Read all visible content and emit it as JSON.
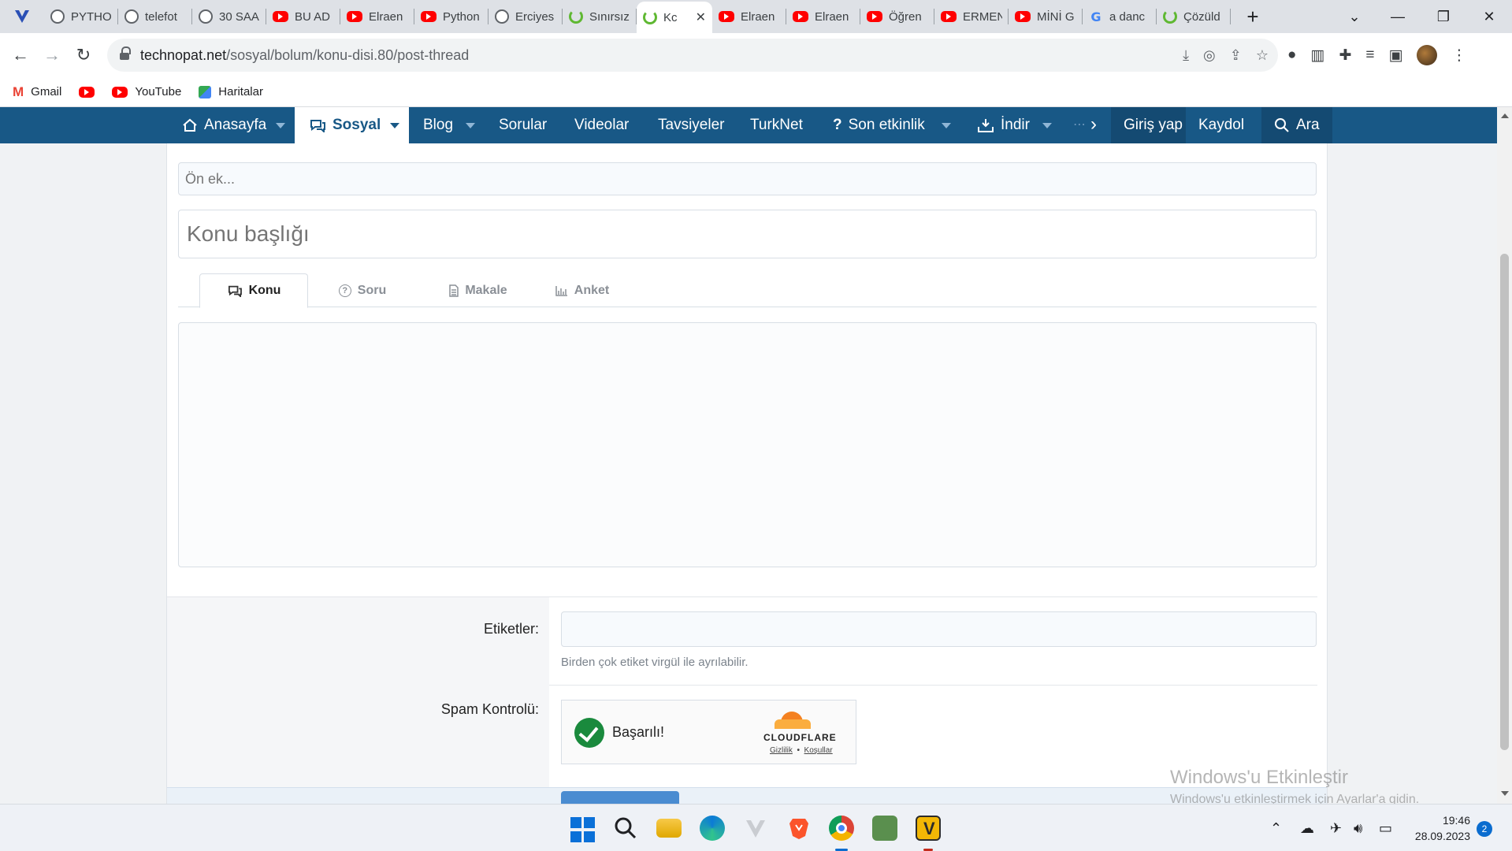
{
  "browser": {
    "tabs": [
      {
        "label": "PYTHO",
        "icon": "globe-icon"
      },
      {
        "label": "telefot",
        "icon": "globe-icon"
      },
      {
        "label": "30 SAA",
        "icon": "globe-icon"
      },
      {
        "label": "BU AD",
        "icon": "youtube-icon"
      },
      {
        "label": "Elraen",
        "icon": "youtube-icon"
      },
      {
        "label": "Python",
        "icon": "youtube-icon"
      },
      {
        "label": "Erciyes",
        "icon": "globe-icon"
      },
      {
        "label": "Sınırsız",
        "icon": "power-icon"
      },
      {
        "label": "Kc",
        "icon": "power-icon",
        "active": true,
        "close": "✕"
      },
      {
        "label": "Elraen",
        "icon": "youtube-icon"
      },
      {
        "label": "Elraen",
        "icon": "youtube-icon"
      },
      {
        "label": "Öğren",
        "icon": "youtube-icon"
      },
      {
        "label": "ERMEN",
        "icon": "youtube-icon"
      },
      {
        "label": "MİNİ G",
        "icon": "youtube-icon"
      },
      {
        "label": "a danc",
        "icon": "google-icon"
      },
      {
        "label": "Çözüld",
        "icon": "power-icon"
      }
    ],
    "new_tab": "+",
    "url_host": "technopat.net",
    "url_path": "/sosyal/bolum/konu-disi.80/post-thread",
    "bookmarks": [
      {
        "label": "Gmail",
        "icon": "gmail-icon"
      },
      {
        "label": "",
        "icon": "youtube-icon"
      },
      {
        "label": "YouTube",
        "icon": "youtube-icon"
      },
      {
        "label": "Haritalar",
        "icon": "maps-icon"
      }
    ]
  },
  "site_nav": {
    "items": [
      {
        "label": "Anasayfa",
        "icon": "home-icon",
        "caret": true
      },
      {
        "label": "Sosyal",
        "icon": "chat-icon",
        "caret": true,
        "selected": true
      },
      {
        "label": "Blog",
        "caret": true
      },
      {
        "label": "Sorular"
      },
      {
        "label": "Videolar"
      },
      {
        "label": "Tavsiyeler"
      },
      {
        "label": "TurkNet"
      },
      {
        "label": "Son etkinlik",
        "icon": "question-icon",
        "caret": true
      },
      {
        "label": "İndir",
        "icon": "download-icon",
        "caret": true
      }
    ],
    "login": "Giriş yap",
    "register": "Kaydol",
    "search": "Ara",
    "colors": {
      "bar": "#185886",
      "bar_dark": "#144a72"
    }
  },
  "form": {
    "prefix_placeholder": "Ön ek...",
    "title_placeholder": "Konu başlığı",
    "type_tabs": [
      {
        "label": "Konu",
        "icon": "chat-icon",
        "active": true
      },
      {
        "label": "Soru",
        "icon": "question-circle-icon"
      },
      {
        "label": "Makale",
        "icon": "document-icon"
      },
      {
        "label": "Anket",
        "icon": "bar-chart-icon"
      }
    ],
    "tags_label": "Etiketler:",
    "tags_hint": "Birden çok etiket virgül ile ayrılabilir.",
    "spam_label": "Spam Kontrolü:",
    "captcha": {
      "status": "Başarılı!",
      "brand": "CLOUDFLARE",
      "privacy": "Gizlilik",
      "separator": "•",
      "terms": "Koşullar"
    }
  },
  "watermark": {
    "title": "Windows'u Etkinleştir",
    "subtitle": "Windows'u etkinleştirmek için Ayarlar'a gidin."
  },
  "taskbar": {
    "time": "19:46",
    "date": "28.09.2023",
    "notifications": "2"
  }
}
